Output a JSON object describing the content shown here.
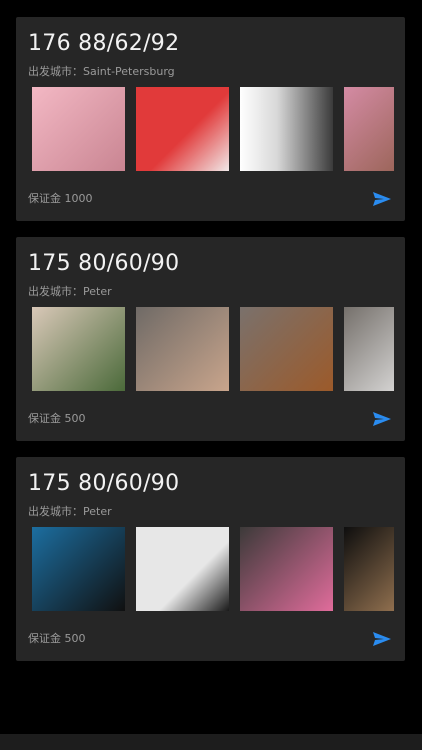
{
  "cards": [
    {
      "title": "176 88/62/92",
      "city": "出发城市：Saint-Petersburg",
      "deposit": "保证金 1000",
      "photos": [
        {
          "desc": "pink-dress",
          "c1": "#f3b8c4",
          "c2": "#c98592"
        },
        {
          "desc": "red-backdrop",
          "c1": "#e13a3a",
          "c2": "#f0e8e8"
        },
        {
          "desc": "white-face",
          "c1": "#ffffff",
          "c2": "#3b3b3b"
        },
        {
          "desc": "pink-eye",
          "c1": "#d48ba4",
          "c2": "#8b5a44"
        }
      ]
    },
    {
      "title": "175 80/60/90",
      "city": "出发城市：Peter",
      "deposit": "保证金 500",
      "photos": [
        {
          "desc": "plant-portrait",
          "c1": "#d9c8b8",
          "c2": "#4b6a3a"
        },
        {
          "desc": "grey-portrait",
          "c1": "#6f6a66",
          "c2": "#c9a58c"
        },
        {
          "desc": "stool-pose",
          "c1": "#7a716c",
          "c2": "#9c5a2a"
        },
        {
          "desc": "white-top",
          "c1": "#75706b",
          "c2": "#f1f1f1"
        }
      ]
    },
    {
      "title": "175 80/60/90",
      "city": "出发城市：Peter",
      "deposit": "保证金 500",
      "photos": [
        {
          "desc": "blue-chair",
          "c1": "#1c6ea0",
          "c2": "#101010"
        },
        {
          "desc": "white-building",
          "c1": "#e7e7e7",
          "c2": "#1a1a1a"
        },
        {
          "desc": "pink-makeup",
          "c1": "#3c3a39",
          "c2": "#e06c9b"
        },
        {
          "desc": "dark-pose",
          "c1": "#0e0e0e",
          "c2": "#b98e63"
        }
      ]
    }
  ],
  "accent": "#2a8cf0"
}
